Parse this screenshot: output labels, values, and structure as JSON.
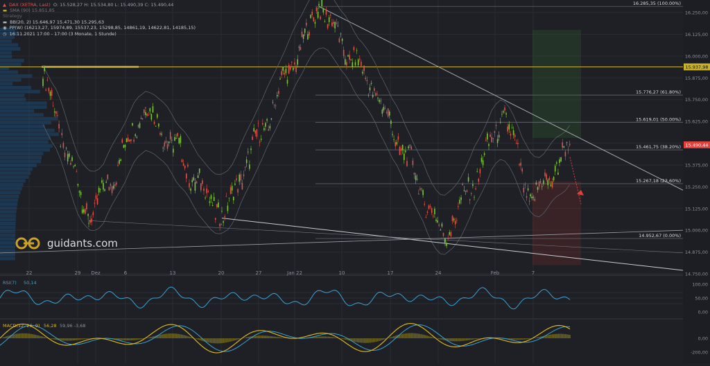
{
  "header": {
    "instrument": "DAX (XETRA, Last)",
    "ohlc": "O: 15.528,27  H: 15.534,80  L: 15.490,39  C: 15.490,44",
    "line2": "SMA (90)  15.851,85",
    "line3": "Strategy",
    "bb": "BB(20, 2)  15.646,97  15.471,30  15.295,63",
    "pp": "PP(W)  (16213,27, 15974,89, 15537,23, 15298,85, 14861,19, 14622,81, 14185,15)",
    "vp": "16.11.2021 17:00 - 17:00   (3 Monate, 1 Stunde)"
  },
  "logo": {
    "text": "guidants.com"
  },
  "colors": {
    "background": "#1e2026",
    "up": "#7ec73b",
    "down": "#e0534a",
    "accent_yellow": "#c9b22a",
    "price_red": "#e2403c",
    "rsi": "#3ba3d6",
    "macd": "#d8b51e",
    "signal": "#3ba3d6"
  },
  "chart_data": [
    {
      "type": "candlestick",
      "title": "DAX (XETRA, Last)",
      "x_tick_labels": [
        "22",
        "29",
        "Dez",
        "6",
        "13",
        "20",
        "27",
        "Jan 22",
        "10",
        "17",
        "24",
        "Feb",
        "7"
      ],
      "y_tick_labels": [
        "16.250,00",
        "16.125,00",
        "16.000,00",
        "15.875,00",
        "15.750,00",
        "15.625,00",
        "15.500,00",
        "15.375,00",
        "15.250,00",
        "15.125,00",
        "15.000,00",
        "14.875,00",
        "14.750,00"
      ],
      "ylim": [
        14750,
        16290
      ],
      "price_tags": [
        {
          "label": "15.937,98",
          "value": 15937.98
        },
        {
          "label": "15.490,44",
          "value": 15490.44
        }
      ],
      "fibonacci_levels": [
        {
          "label": "16.285,35 (100.00%)",
          "value": 16285.35
        },
        {
          "label": "15.776,27 (61.80%)",
          "value": 15776.27
        },
        {
          "label": "15.619,01 (50.00%)",
          "value": 15619.01
        },
        {
          "label": "15.461,75 (38.20%)",
          "value": 15461.75
        },
        {
          "label": "15.267,18 (23.60%)",
          "value": 15267.18
        },
        {
          "label": "14.952,67 (0.00%)",
          "value": 14952.67
        }
      ],
      "key_points": [
        {
          "x": "22",
          "value": 15900
        },
        {
          "x": "29",
          "value": 15050
        },
        {
          "x": "6",
          "value": 15720
        },
        {
          "x": "20",
          "value": 15070
        },
        {
          "x": "Jan 22",
          "value": 16285
        },
        {
          "x": "17",
          "value": 15760
        },
        {
          "x": "24",
          "value": 14952
        },
        {
          "x": "Feb",
          "value": 15650
        },
        {
          "x": "7",
          "value": 15150
        },
        {
          "x": "last",
          "value": 15490
        }
      ]
    },
    {
      "type": "line",
      "title": "RSI(7)",
      "value_label": "50,14",
      "y_tick_labels": [
        "100,00",
        "50,00",
        "0,00"
      ],
      "ylim": [
        0,
        100
      ]
    },
    {
      "type": "line",
      "title": "MACD(12, 26, 9)",
      "value_label": "56,28",
      "extra_values": "59,96  -3,68",
      "y_tick_labels": [
        "0,00",
        "-200,00"
      ]
    }
  ]
}
